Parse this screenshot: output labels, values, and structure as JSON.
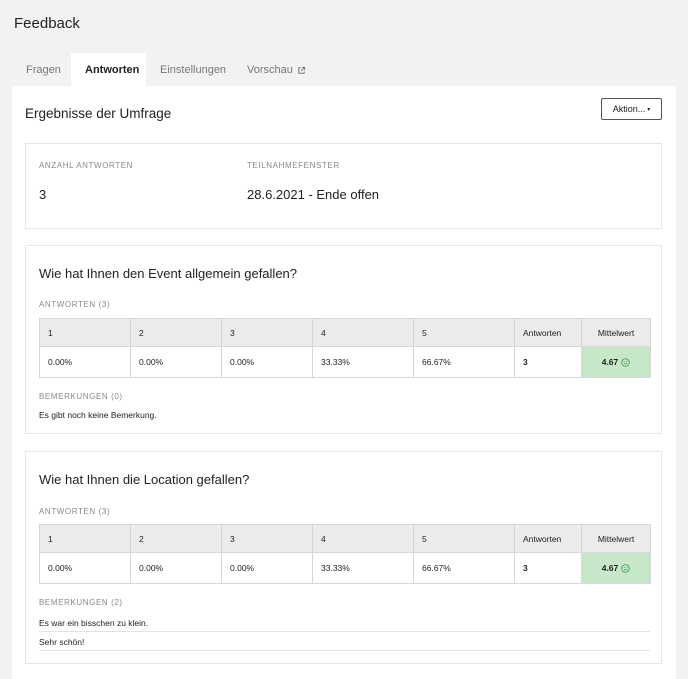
{
  "page": {
    "title": "Feedback"
  },
  "tabs": [
    {
      "label": "Fragen"
    },
    {
      "label": "Antworten"
    },
    {
      "label": "Einstellungen"
    },
    {
      "label": "Vorschau",
      "icon": "external-link-icon"
    }
  ],
  "panel": {
    "title": "Ergebnisse der Umfrage",
    "action_label": "Aktion...",
    "action_caret": "▾"
  },
  "summary": {
    "count_label": "ANZAHL ANTWORTEN",
    "count_value": "3",
    "window_label": "TEILNAHMEFENSTER",
    "window_value": "28.6.2021 - Ende offen"
  },
  "questions": [
    {
      "title": "Wie hat Ihnen den Event allgemein gefallen?",
      "answers_label": "ANTWORTEN (3)",
      "headers": [
        "1",
        "2",
        "3",
        "4",
        "5",
        "Antworten",
        "Mittelwert"
      ],
      "row": [
        "0.00%",
        "0.00%",
        "0.00%",
        "33.33%",
        "66.67%",
        "3",
        "4.67"
      ],
      "comments_label": "BEMERKUNGEN (0)",
      "empty_text": "Es gibt noch keine Bemerkung.",
      "comments": []
    },
    {
      "title": "Wie hat Ihnen die Location gefallen?",
      "answers_label": "ANTWORTEN (3)",
      "headers": [
        "1",
        "2",
        "3",
        "4",
        "5",
        "Antworten",
        "Mittelwert"
      ],
      "row": [
        "0.00%",
        "0.00%",
        "0.00%",
        "33.33%",
        "66.67%",
        "3",
        "4.67"
      ],
      "comments_label": "BEMERKUNGEN (2)",
      "comments": [
        "Es war ein bisschen zu klein.",
        "Sehr schön!"
      ]
    }
  ],
  "colors": {
    "average_bg": "#c6e8c9",
    "smiley": "#3a9a4c"
  },
  "icons": {
    "average": "smiley-icon"
  }
}
